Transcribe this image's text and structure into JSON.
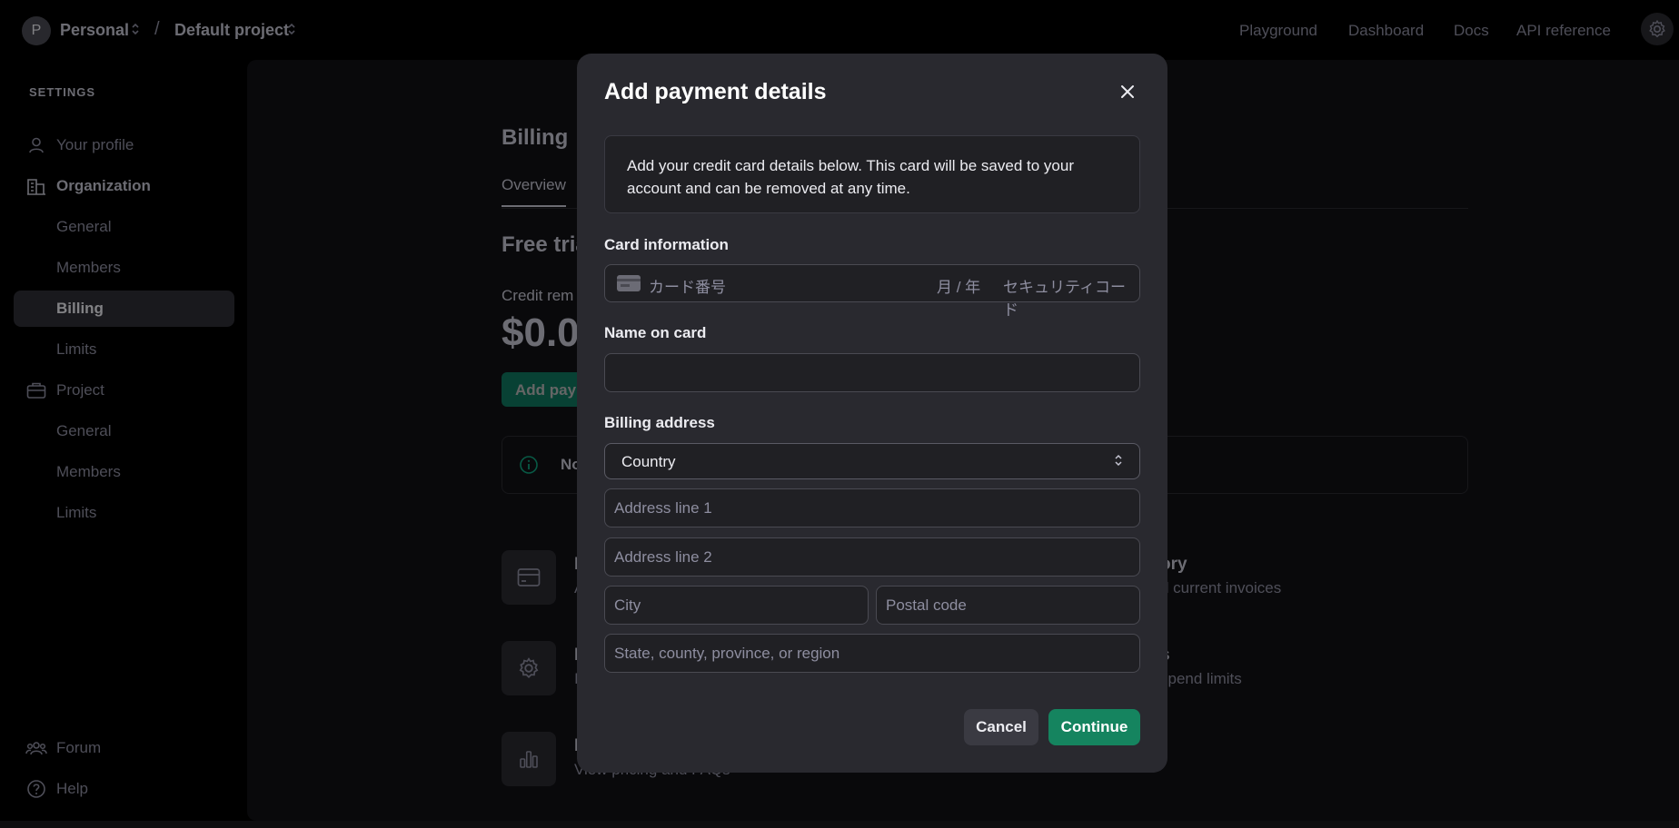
{
  "topbar": {
    "avatar_letter": "P",
    "org": "Personal",
    "separator": "/",
    "project": "Default project",
    "nav": [
      "Playground",
      "Dashboard",
      "Docs",
      "API reference"
    ]
  },
  "sidebar": {
    "section_label": "SETTINGS",
    "items": [
      {
        "label": "Your profile",
        "icon": "user-icon"
      },
      {
        "label": "Organization",
        "icon": "building-icon"
      },
      {
        "label": "General"
      },
      {
        "label": "Members"
      },
      {
        "label": "Billing"
      },
      {
        "label": "Limits"
      },
      {
        "label": "Project",
        "icon": "briefcase-icon"
      },
      {
        "label": "General"
      },
      {
        "label": "Members"
      },
      {
        "label": "Limits"
      }
    ],
    "footer": [
      {
        "label": "Forum",
        "icon": "people-icon"
      },
      {
        "label": "Help",
        "icon": "help-icon"
      }
    ]
  },
  "main": {
    "title": "Billing",
    "tab": "Overview",
    "free_trial": "Free tria",
    "credit_label": "Credit rem",
    "credit_amount": "$0.0",
    "add_payment_button": "Add paym",
    "notice_text": "No",
    "tiles": [
      {
        "title": "P",
        "subtitle": "A",
        "icon": "credit-card-icon"
      },
      {
        "title": "P",
        "subtitle": "I",
        "icon": "gear-icon"
      },
      {
        "title": "P",
        "subtitle": "View pricing and FAQs",
        "icon": "bar-chart-icon"
      }
    ],
    "right_tiles": [
      {
        "title": "ory",
        "subtitle": "d current invoices"
      },
      {
        "title": "s",
        "subtitle": "spend limits"
      }
    ]
  },
  "modal": {
    "title": "Add payment details",
    "info": "Add your credit card details below. This card will be saved to your account and can be removed at any time.",
    "card_label": "Card information",
    "card_number_placeholder": "カード番号",
    "card_expiry_placeholder": "月 / 年",
    "card_cvc_placeholder": "セキュリティコード",
    "name_label": "Name on card",
    "name_value": "",
    "billing_label": "Billing address",
    "country": "Country",
    "address1_placeholder": "Address line 1",
    "address2_placeholder": "Address line 2",
    "city_placeholder": "City",
    "postal_placeholder": "Postal code",
    "state_placeholder": "State, county, province, or region",
    "cancel": "Cancel",
    "continue": "Continue"
  }
}
